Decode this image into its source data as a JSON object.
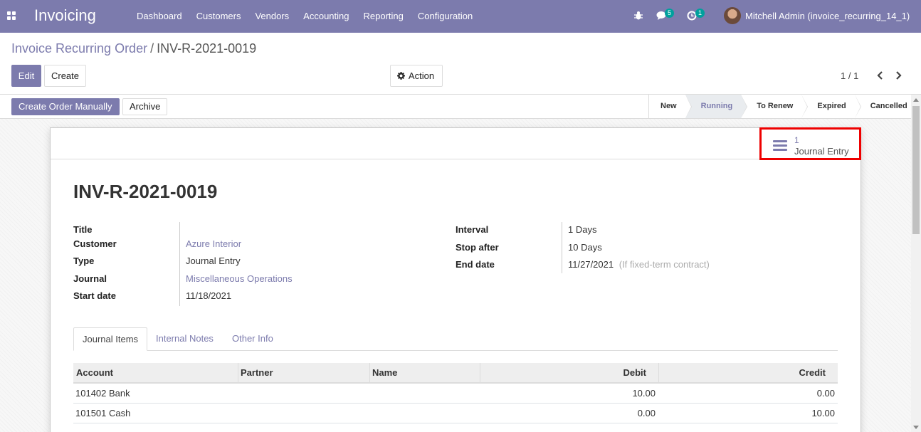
{
  "navbar": {
    "brand": "Invoicing",
    "menu": [
      "Dashboard",
      "Customers",
      "Vendors",
      "Accounting",
      "Reporting",
      "Configuration"
    ],
    "chat_badge": "5",
    "activity_badge": "1",
    "user": "Mitchell Admin (invoice_recurring_14_1)",
    "color": "#7c7bad"
  },
  "breadcrumb": {
    "parent": "Invoice Recurring Order",
    "separator": "/",
    "current": "INV-R-2021-0019"
  },
  "buttons": {
    "edit": "Edit",
    "create": "Create",
    "action": "Action",
    "create_manual": "Create Order Manually",
    "archive": "Archive"
  },
  "pager": {
    "value": "1 / 1"
  },
  "stages": [
    {
      "label": "New",
      "active": false
    },
    {
      "label": "Running",
      "active": true
    },
    {
      "label": "To Renew",
      "active": false
    },
    {
      "label": "Expired",
      "active": false
    },
    {
      "label": "Cancelled",
      "active": false
    }
  ],
  "smart_button": {
    "count": "1",
    "label": "Journal Entry"
  },
  "record": {
    "title": "INV-R-2021-0019",
    "left_fields": [
      {
        "label": "Title",
        "value": "",
        "link": false
      },
      {
        "label": "Customer",
        "value": "Azure Interior",
        "link": true
      },
      {
        "label": "Type",
        "value": "Journal Entry",
        "link": false
      },
      {
        "label": "Journal",
        "value": "Miscellaneous Operations",
        "link": true
      },
      {
        "label": "Start date",
        "value": "11/18/2021",
        "link": false
      }
    ],
    "right_fields": [
      {
        "label": "Interval",
        "value": "1 Days",
        "hint": ""
      },
      {
        "label": "Stop after",
        "value": "10 Days",
        "hint": ""
      },
      {
        "label": "End date",
        "value": "11/27/2021",
        "hint": "(If fixed-term contract)"
      }
    ]
  },
  "tabs": [
    "Journal Items",
    "Internal Notes",
    "Other Info"
  ],
  "table": {
    "columns": [
      "Account",
      "Partner",
      "Name",
      "Debit",
      "Credit"
    ],
    "rows": [
      {
        "account": "101402 Bank",
        "partner": "",
        "name": "",
        "debit": "10.00",
        "credit": "0.00"
      },
      {
        "account": "101501 Cash",
        "partner": "",
        "name": "",
        "debit": "0.00",
        "credit": "10.00"
      }
    ]
  }
}
